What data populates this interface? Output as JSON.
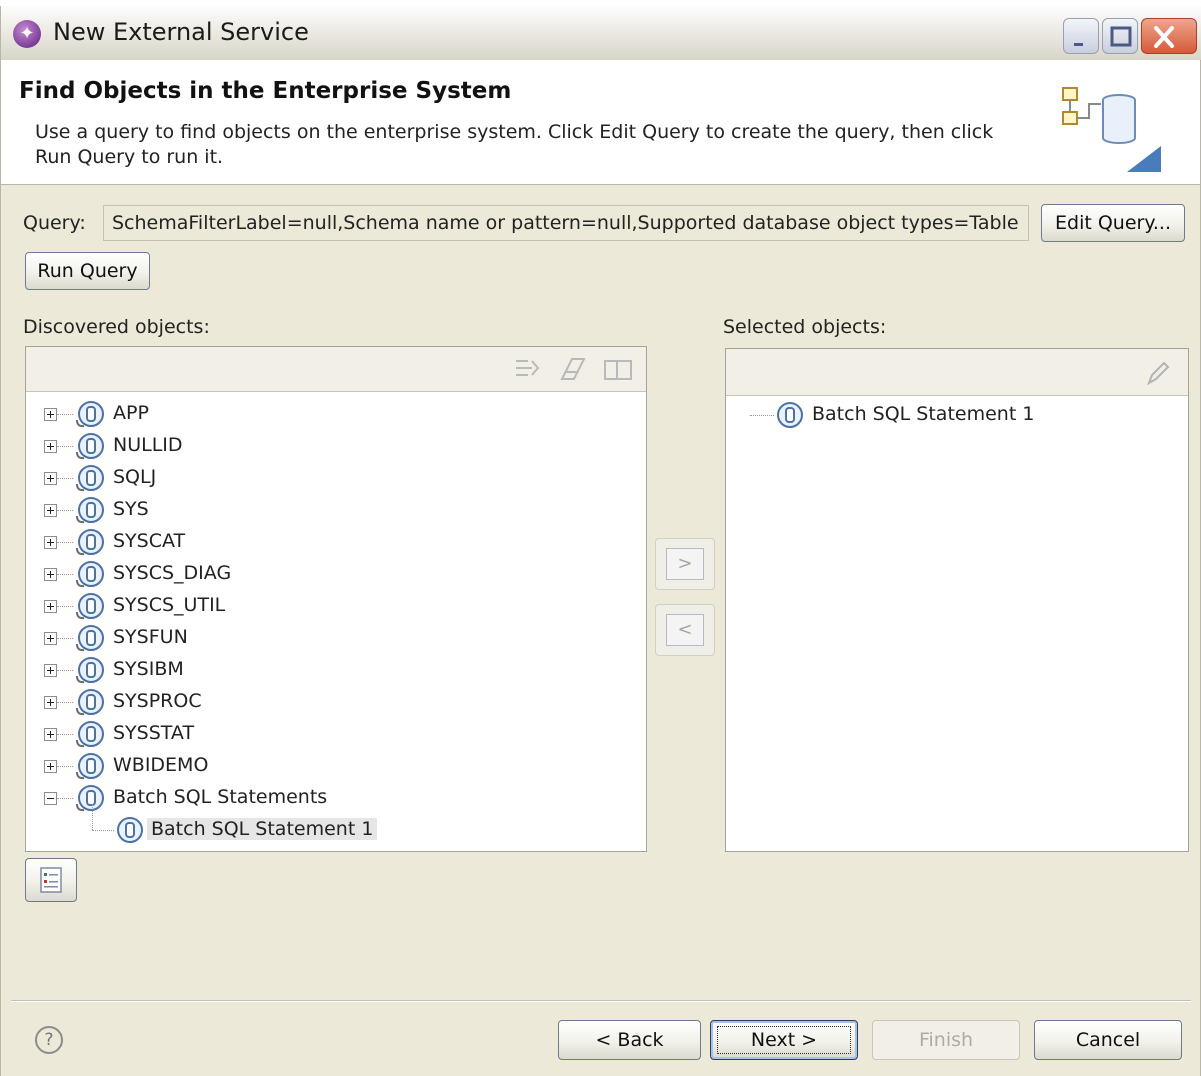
{
  "window": {
    "title": "New External Service"
  },
  "header": {
    "title": "Find Objects in the Enterprise System",
    "description": "Use a query to find objects on the enterprise system.  Click Edit Query to create the query, then click Run Query to run it."
  },
  "query": {
    "label": "Query:",
    "value": "SchemaFilterLabel=null,Schema name or pattern=null,Supported database object types=Table",
    "edit_button": "Edit Query...",
    "run_button": "Run Query"
  },
  "discovered": {
    "label": "Discovered objects:",
    "items": [
      {
        "label": "APP",
        "expanded": false
      },
      {
        "label": "NULLID",
        "expanded": false
      },
      {
        "label": "SQLJ",
        "expanded": false
      },
      {
        "label": "SYS",
        "expanded": false
      },
      {
        "label": "SYSCAT",
        "expanded": false
      },
      {
        "label": "SYSCS_DIAG",
        "expanded": false
      },
      {
        "label": "SYSCS_UTIL",
        "expanded": false
      },
      {
        "label": "SYSFUN",
        "expanded": false
      },
      {
        "label": "SYSIBM",
        "expanded": false
      },
      {
        "label": "SYSPROC",
        "expanded": false
      },
      {
        "label": "SYSSTAT",
        "expanded": false
      },
      {
        "label": "WBIDEMO",
        "expanded": false
      },
      {
        "label": "Batch SQL Statements",
        "expanded": true
      }
    ],
    "child": {
      "label": "Batch SQL Statement 1"
    }
  },
  "transfer": {
    "add_label": ">",
    "remove_label": "<"
  },
  "selected": {
    "label": "Selected objects:",
    "items": [
      {
        "label": "Batch SQL Statement 1"
      }
    ]
  },
  "footer": {
    "back": "< Back",
    "next": "Next >",
    "finish": "Finish",
    "cancel": "Cancel",
    "help_symbol": "?"
  }
}
